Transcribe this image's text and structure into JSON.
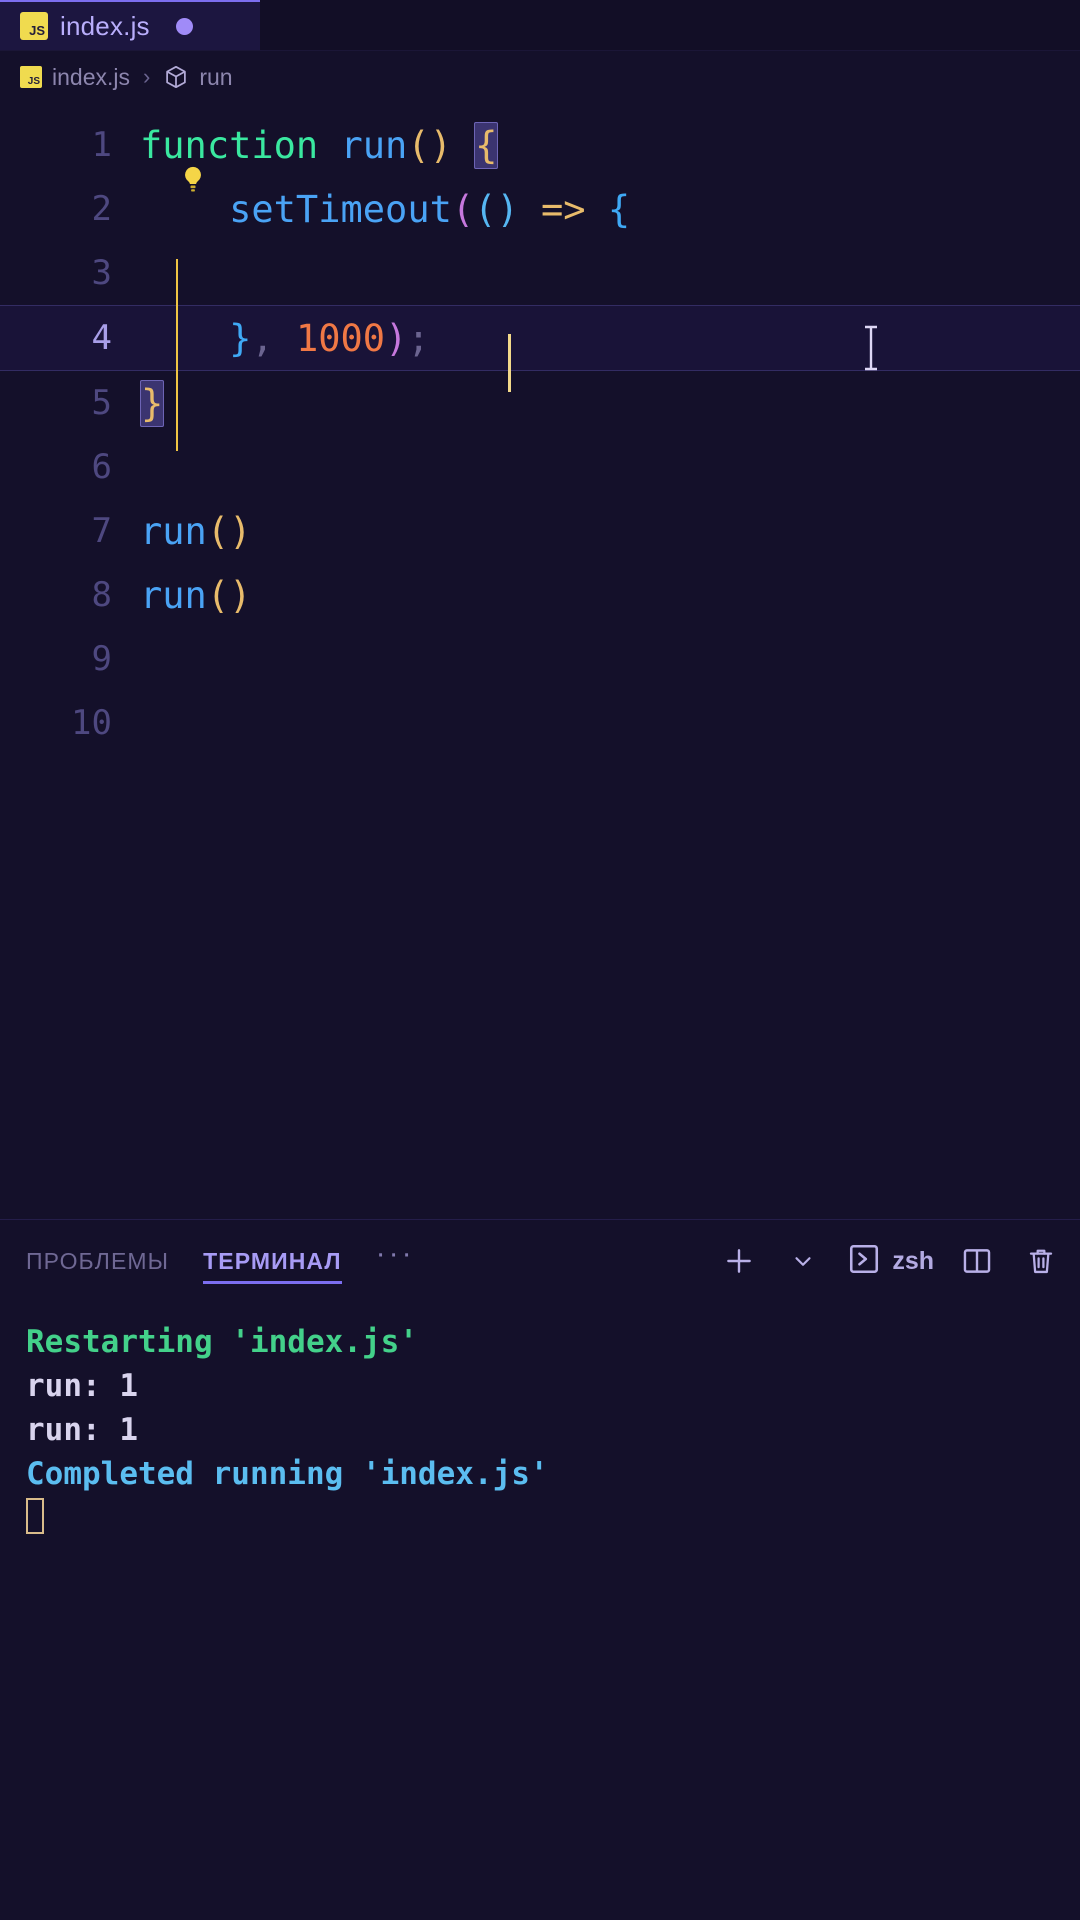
{
  "window": {
    "theme_bg": "#14102a",
    "accent": "#7c6ef0"
  },
  "tabbar": {
    "tabs": [
      {
        "file_icon": "js-file-icon",
        "label": "index.js",
        "dirty": true,
        "active": true
      }
    ]
  },
  "breadcrumb": {
    "file_icon": "js-file-icon",
    "file": "index.js",
    "separator": "›",
    "symbol_icon": "cube-symbol-icon",
    "symbol": "run"
  },
  "editor": {
    "language": "javascript",
    "current_line": 4,
    "lines": [
      {
        "number": "1",
        "tokens": [
          {
            "t": "function",
            "c": "kw"
          },
          {
            "t": " ",
            "c": "punct"
          },
          {
            "t": "run",
            "c": "fn"
          },
          {
            "t": "(",
            "c": "paren"
          },
          {
            "t": ")",
            "c": "paren"
          },
          {
            "t": " ",
            "c": "punct"
          },
          {
            "t": "{",
            "c": "brace bmatch"
          }
        ]
      },
      {
        "number": "2",
        "tokens": [
          {
            "t": "    ",
            "c": "punct"
          },
          {
            "t": "setTimeout",
            "c": "fn"
          },
          {
            "t": "(",
            "c": "paren2"
          },
          {
            "t": "(",
            "c": "paren3"
          },
          {
            "t": ")",
            "c": "paren3"
          },
          {
            "t": " ",
            "c": "punct"
          },
          {
            "t": "=>",
            "c": "arrow"
          },
          {
            "t": " ",
            "c": "punct"
          },
          {
            "t": "{",
            "c": "brace2"
          }
        ]
      },
      {
        "number": "3",
        "tokens": []
      },
      {
        "number": "4",
        "tokens": [
          {
            "t": "    ",
            "c": "punct"
          },
          {
            "t": "}",
            "c": "brace2"
          },
          {
            "t": ",",
            "c": "punct"
          },
          {
            "t": " ",
            "c": "punct"
          },
          {
            "t": "1000",
            "c": "num"
          },
          {
            "t": ")",
            "c": "paren2"
          },
          {
            "t": ";",
            "c": "punct"
          }
        ]
      },
      {
        "number": "5",
        "tokens": [
          {
            "t": "}",
            "c": "brace bmatch"
          }
        ]
      },
      {
        "number": "6",
        "tokens": []
      },
      {
        "number": "7",
        "tokens": [
          {
            "t": "run",
            "c": "fn"
          },
          {
            "t": "(",
            "c": "paren"
          },
          {
            "t": ")",
            "c": "paren"
          }
        ]
      },
      {
        "number": "8",
        "tokens": [
          {
            "t": "run",
            "c": "fn"
          },
          {
            "t": "(",
            "c": "paren"
          },
          {
            "t": ")",
            "c": "paren"
          }
        ]
      },
      {
        "number": "9",
        "tokens": []
      },
      {
        "number": "10",
        "tokens": []
      }
    ],
    "code_action_hint": "lightbulb-icon"
  },
  "panel": {
    "tabs": [
      {
        "label": "ПРОБЛЕМЫ",
        "active": false
      },
      {
        "label": "ТЕРМИНАЛ",
        "active": true
      }
    ],
    "overflow_label": "···",
    "actions": {
      "new_terminal": "plus-icon",
      "new_terminal_dropdown": "chevron-down-icon",
      "shell_icon": "terminal-prompt-icon",
      "shell_name": "zsh",
      "split_terminal": "split-panel-icon",
      "kill_terminal": "trash-icon"
    }
  },
  "terminal": {
    "lines": [
      {
        "text": "Restarting 'index.js'",
        "color": "t-green"
      },
      {
        "text": "run: 1",
        "color": "t-white"
      },
      {
        "text": "run: 1",
        "color": "t-white"
      },
      {
        "text": "Completed running 'index.js'",
        "color": "t-blue"
      }
    ],
    "cursor": "block-cursor"
  }
}
